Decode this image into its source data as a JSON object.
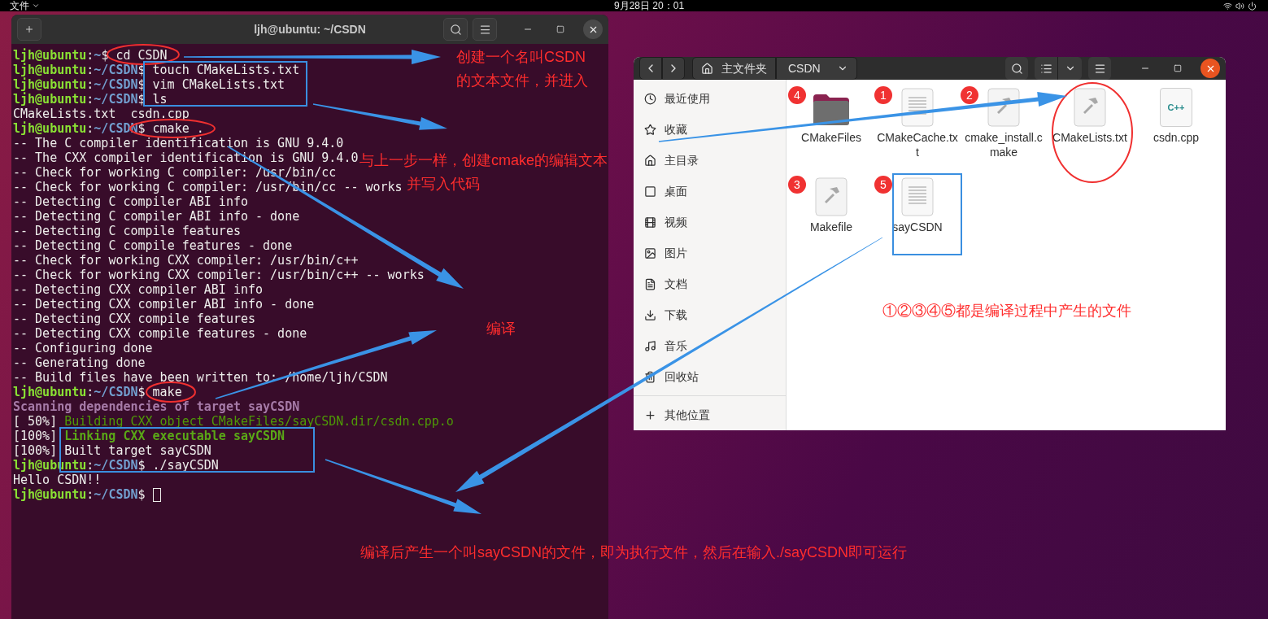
{
  "top_bar": {
    "app_menu": "文件",
    "clock": "9月28日 20：01"
  },
  "terminal": {
    "title": "ljh@ubuntu: ~/CSDN",
    "lines": [
      {
        "kind": "prompt",
        "user": "ljh@ubuntu",
        "sep": ":",
        "path": "~",
        "symbol": "$",
        "command": "cd CSDN",
        "cursor": false
      },
      {
        "kind": "prompt",
        "user": "ljh@ubuntu",
        "sep": ":",
        "path": "~/CSDN",
        "symbol": "$",
        "command": "touch CMakeLists.txt",
        "cursor": false
      },
      {
        "kind": "prompt",
        "user": "ljh@ubuntu",
        "sep": ":",
        "path": "~/CSDN",
        "symbol": "$",
        "command": "vim CMakeLists.txt",
        "cursor": false
      },
      {
        "kind": "prompt",
        "user": "ljh@ubuntu",
        "sep": ":",
        "path": "~/CSDN",
        "symbol": "$",
        "command": "ls",
        "cursor": false
      },
      {
        "kind": "output",
        "text": "CMakeLists.txt  csdn.cpp"
      },
      {
        "kind": "prompt",
        "user": "ljh@ubuntu",
        "sep": ":",
        "path": "~/CSDN",
        "symbol": "$",
        "command": "cmake .",
        "cursor": false
      },
      {
        "kind": "output",
        "text": "-- The C compiler identification is GNU 9.4.0"
      },
      {
        "kind": "output",
        "text": "-- The CXX compiler identification is GNU 9.4.0"
      },
      {
        "kind": "output",
        "text": "-- Check for working C compiler: /usr/bin/cc"
      },
      {
        "kind": "output",
        "text": "-- Check for working C compiler: /usr/bin/cc -- works"
      },
      {
        "kind": "output",
        "text": "-- Detecting C compiler ABI info"
      },
      {
        "kind": "output",
        "text": "-- Detecting C compiler ABI info - done"
      },
      {
        "kind": "output",
        "text": "-- Detecting C compile features"
      },
      {
        "kind": "output",
        "text": "-- Detecting C compile features - done"
      },
      {
        "kind": "output",
        "text": "-- Check for working CXX compiler: /usr/bin/c++"
      },
      {
        "kind": "output",
        "text": "-- Check for working CXX compiler: /usr/bin/c++ -- works"
      },
      {
        "kind": "output",
        "text": "-- Detecting CXX compiler ABI info"
      },
      {
        "kind": "output",
        "text": "-- Detecting CXX compiler ABI info - done"
      },
      {
        "kind": "output",
        "text": "-- Detecting CXX compile features"
      },
      {
        "kind": "output",
        "text": "-- Detecting CXX compile features - done"
      },
      {
        "kind": "output",
        "text": "-- Configuring done"
      },
      {
        "kind": "output",
        "text": "-- Generating done"
      },
      {
        "kind": "output",
        "text": "-- Build files have been written to: /home/ljh/CSDN"
      },
      {
        "kind": "prompt",
        "user": "ljh@ubuntu",
        "sep": ":",
        "path": "~/CSDN",
        "symbol": "$",
        "command": "make",
        "cursor": false
      },
      {
        "kind": "scan",
        "text": "Scanning dependencies of target sayCSDN"
      },
      {
        "kind": "build",
        "prefix": "[ 50%]",
        "text": "Building CXX object CMakeFiles/sayCSDN.dir/csdn.cpp.o"
      },
      {
        "kind": "link",
        "prefix": "[100%]",
        "text": "Linking CXX executable sayCSDN"
      },
      {
        "kind": "built",
        "prefix": "[100%]",
        "text": "Built target sayCSDN"
      },
      {
        "kind": "prompt",
        "user": "ljh@ubuntu",
        "sep": ":",
        "path": "~/CSDN",
        "symbol": "$",
        "command": "./sayCSDN",
        "cursor": false
      },
      {
        "kind": "output",
        "text": "Hello CSDN!!"
      },
      {
        "kind": "prompt",
        "user": "ljh@ubuntu",
        "sep": ":",
        "path": "~/CSDN",
        "symbol": "$",
        "cursor": true
      }
    ]
  },
  "file_manager": {
    "path": [
      {
        "kind": "home",
        "label": "主文件夹"
      },
      {
        "kind": "current",
        "label": "CSDN"
      }
    ],
    "sidebar": [
      {
        "label": "最近使用"
      },
      {
        "label": "收藏"
      },
      {
        "label": "主目录"
      },
      {
        "label": "桌面"
      },
      {
        "label": "视频"
      },
      {
        "label": "图片"
      },
      {
        "label": "文档"
      },
      {
        "label": "下载"
      },
      {
        "label": "音乐"
      },
      {
        "label": "回收站"
      },
      {
        "label": "其他位置"
      }
    ],
    "files": [
      {
        "name": "CMakeFiles",
        "kind": "folder",
        "badge": "4"
      },
      {
        "name": "CMakeCache.txt",
        "kind": "text",
        "badge": "1"
      },
      {
        "name": "cmake_install.cmake",
        "kind": "script",
        "badge": "2"
      },
      {
        "name": "CMakeLists.txt",
        "kind": "script"
      },
      {
        "name": "csdn.cpp",
        "kind": "cpp",
        "icon_label": "C++"
      },
      {
        "name": "Makefile",
        "kind": "script",
        "badge": "3"
      },
      {
        "name": "sayCSDN",
        "kind": "text",
        "badge": "5"
      }
    ]
  },
  "annotations": [
    "创建一个名叫CSDN",
    "的文本文件，并进入",
    "与上一步一样，创建cmake的编辑文本",
    "并写入代码",
    "编译",
    "①②③④⑤都是编译过程中产生的文件",
    "编译后产生一个叫sayCSDN的文件，即为执行文件，然后在输入./sayCSDN即可运行"
  ]
}
